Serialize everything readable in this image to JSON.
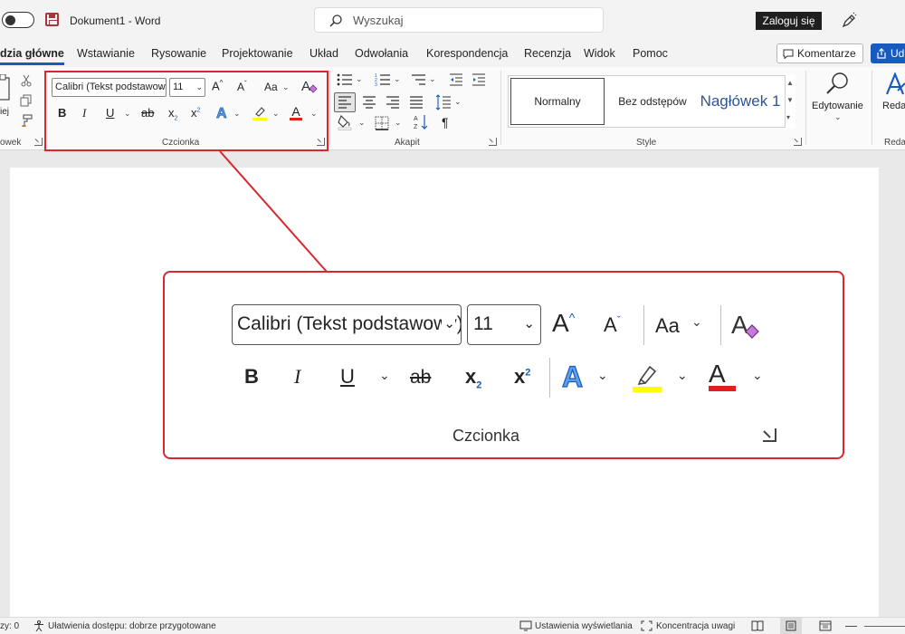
{
  "titlebar": {
    "doc_title": "Dokument1  -  Word",
    "search_placeholder": "Wyszukaj",
    "login_label": "Zaloguj się"
  },
  "tabs": [
    {
      "label": "dzia główne",
      "active": true
    },
    {
      "label": "Wstawianie"
    },
    {
      "label": "Rysowanie"
    },
    {
      "label": "Projektowanie"
    },
    {
      "label": "Układ"
    },
    {
      "label": "Odwołania"
    },
    {
      "label": "Korespondencja"
    },
    {
      "label": "Recenzja"
    },
    {
      "label": "Widok"
    },
    {
      "label": "Pomoc"
    }
  ],
  "header_buttons": {
    "comments_label": "Komentarze",
    "share_label": "Ud"
  },
  "ribbon": {
    "clipboard": {
      "paste_label": "iej",
      "group_label": "owek"
    },
    "font": {
      "font_name": "Calibri (Tekst podstawowy)",
      "font_size": "11",
      "grow_label": "A",
      "shrink_label": "A",
      "case_label": "Aa",
      "bold_label": "B",
      "italic_label": "I",
      "underline_label": "U",
      "strike_label": "ab",
      "subscript_label": "x",
      "superscript_label": "x",
      "font_color_label": "A",
      "group_label": "Czcionka"
    },
    "paragraph": {
      "group_label": "Akapit"
    },
    "styles": {
      "items": [
        "Normalny",
        "Bez odstępów",
        "Nagłówek 1"
      ],
      "group_label": "Style"
    },
    "editing": {
      "label": "Edytowanie"
    },
    "editor": {
      "label": "Reda",
      "group_label": "Reda"
    }
  },
  "callout": {
    "font_name": "Calibri (Tekst podstawowy)",
    "font_size": "11",
    "grow_label": "A",
    "shrink_label": "A",
    "case_label": "Aa",
    "bold_label": "B",
    "italic_label": "I",
    "underline_label": "U",
    "strike_label": "ab",
    "subscript_label": "x",
    "superscript_label": "x",
    "font_color_label": "A",
    "group_label": "Czcionka"
  },
  "statusbar": {
    "words": "zy: 0",
    "accessibility": "Ułatwienia dostępu: dobrze przygotowane",
    "display_settings": "Ustawienia wyświetlania",
    "focus": "Koncentracja uwagi"
  },
  "colors": {
    "accent": "#185abd",
    "highlight_frame": "#d9272e",
    "highlighter": "#ffff00",
    "font_color": "#e0201b"
  }
}
